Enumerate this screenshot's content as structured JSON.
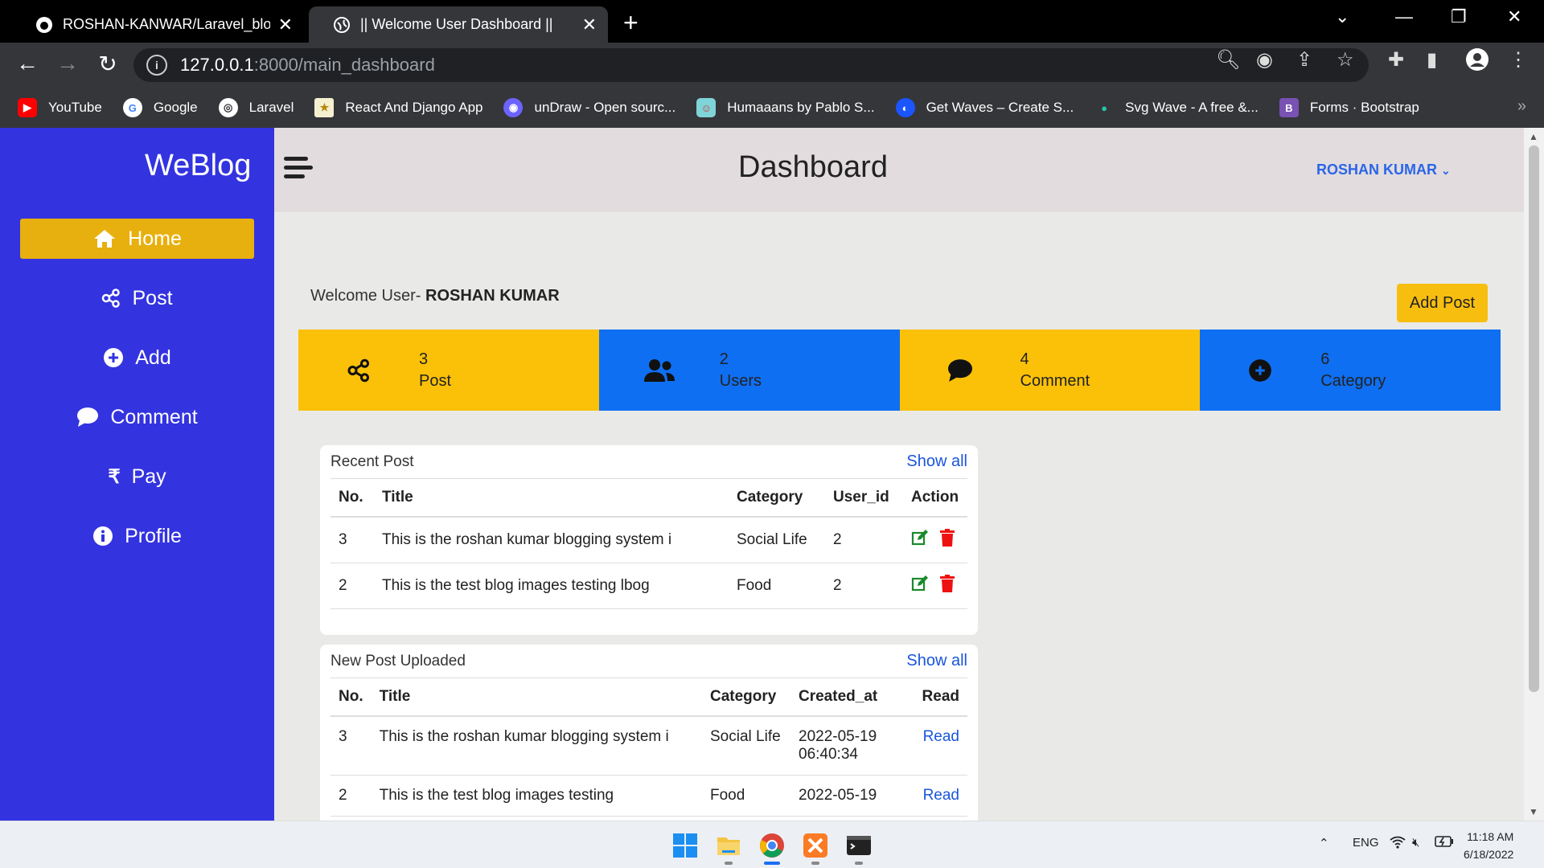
{
  "browser": {
    "tabs": [
      {
        "title": "ROSHAN-KANWAR/Laravel_blog: Bl",
        "icon": "github-icon",
        "active": false
      },
      {
        "title": "|| Welcome User Dashboard ||",
        "icon": "globe-icon",
        "active": true
      }
    ],
    "url_host": "127.0.0.1",
    "url_rest": ":8000/main_dashboard",
    "bookmarks": [
      {
        "label": "YouTube",
        "color": "#ff0000",
        "glyph": "▶"
      },
      {
        "label": "Google",
        "color": "#ffffff",
        "glyph": "G"
      },
      {
        "label": "Laravel",
        "color": "#ffffff",
        "glyph": "◎"
      },
      {
        "label": "React And Django App",
        "color": "#f5f0d0",
        "glyph": "★"
      },
      {
        "label": "unDraw - Open sourc...",
        "color": "#6c63ff",
        "glyph": "◉"
      },
      {
        "label": "Humaaans by Pablo S...",
        "color": "#7fd4d8",
        "glyph": "☺"
      },
      {
        "label": "Get Waves – Create S...",
        "color": "#1a55ff",
        "glyph": "◐"
      },
      {
        "label": "Svg Wave - A free &...",
        "color": "#26c6a8",
        "glyph": "●"
      },
      {
        "label": "Forms · Bootstrap",
        "color": "#7952b3",
        "glyph": "B"
      }
    ]
  },
  "sidebar": {
    "brand": "WeBlog",
    "items": [
      {
        "label": "Home",
        "icon": "home-icon",
        "active": true
      },
      {
        "label": "Post",
        "icon": "share-icon"
      },
      {
        "label": "Add",
        "icon": "plus-circle-icon"
      },
      {
        "label": "Comment",
        "icon": "comment-icon"
      },
      {
        "label": "Pay",
        "icon": "rupee-icon"
      },
      {
        "label": "Profile",
        "icon": "info-icon"
      }
    ]
  },
  "header": {
    "title": "Dashboard",
    "user": "ROSHAN KUMAR"
  },
  "welcome": {
    "prefix": "Welcome User-",
    "name": "ROSHAN KUMAR"
  },
  "add_post_label": "Add Post",
  "stats": [
    {
      "count": "3",
      "label": "Post",
      "icon": "share-icon",
      "color": "#fbc108"
    },
    {
      "count": "2",
      "label": "Users",
      "icon": "users-icon",
      "color": "#0f6ff2"
    },
    {
      "count": "4",
      "label": "Comment",
      "icon": "comment-icon",
      "color": "#fbc108"
    },
    {
      "count": "6",
      "label": "Category",
      "icon": "plus-circle-icon",
      "color": "#0f6ff2"
    }
  ],
  "recent_post": {
    "heading": "Recent Post",
    "show_all": "Show all",
    "columns": [
      "No.",
      "Title",
      "Category",
      "User_id",
      "Action"
    ],
    "rows": [
      {
        "no": "3",
        "title": "This is the roshan kumar blogging system i",
        "category": "Social Life",
        "user_id": "2"
      },
      {
        "no": "2",
        "title": "This is the test blog images testing lbog",
        "category": "Food",
        "user_id": "2"
      }
    ]
  },
  "new_posts": {
    "heading": "New Post Uploaded",
    "show_all": "Show all",
    "columns": [
      "No.",
      "Title",
      "Category",
      "Created_at",
      "Read"
    ],
    "rows": [
      {
        "no": "3",
        "title": "This is the roshan kumar blogging system i",
        "category": "Social Life",
        "created_at": "2022-05-19 06:40:34",
        "read": "Read"
      },
      {
        "no": "2",
        "title": "This is the test blog images testing",
        "category": "Food",
        "created_at": "2022-05-19",
        "read": "Read"
      }
    ]
  },
  "taskbar": {
    "lang": "ENG",
    "time": "11:18 AM",
    "date": "6/18/2022"
  }
}
